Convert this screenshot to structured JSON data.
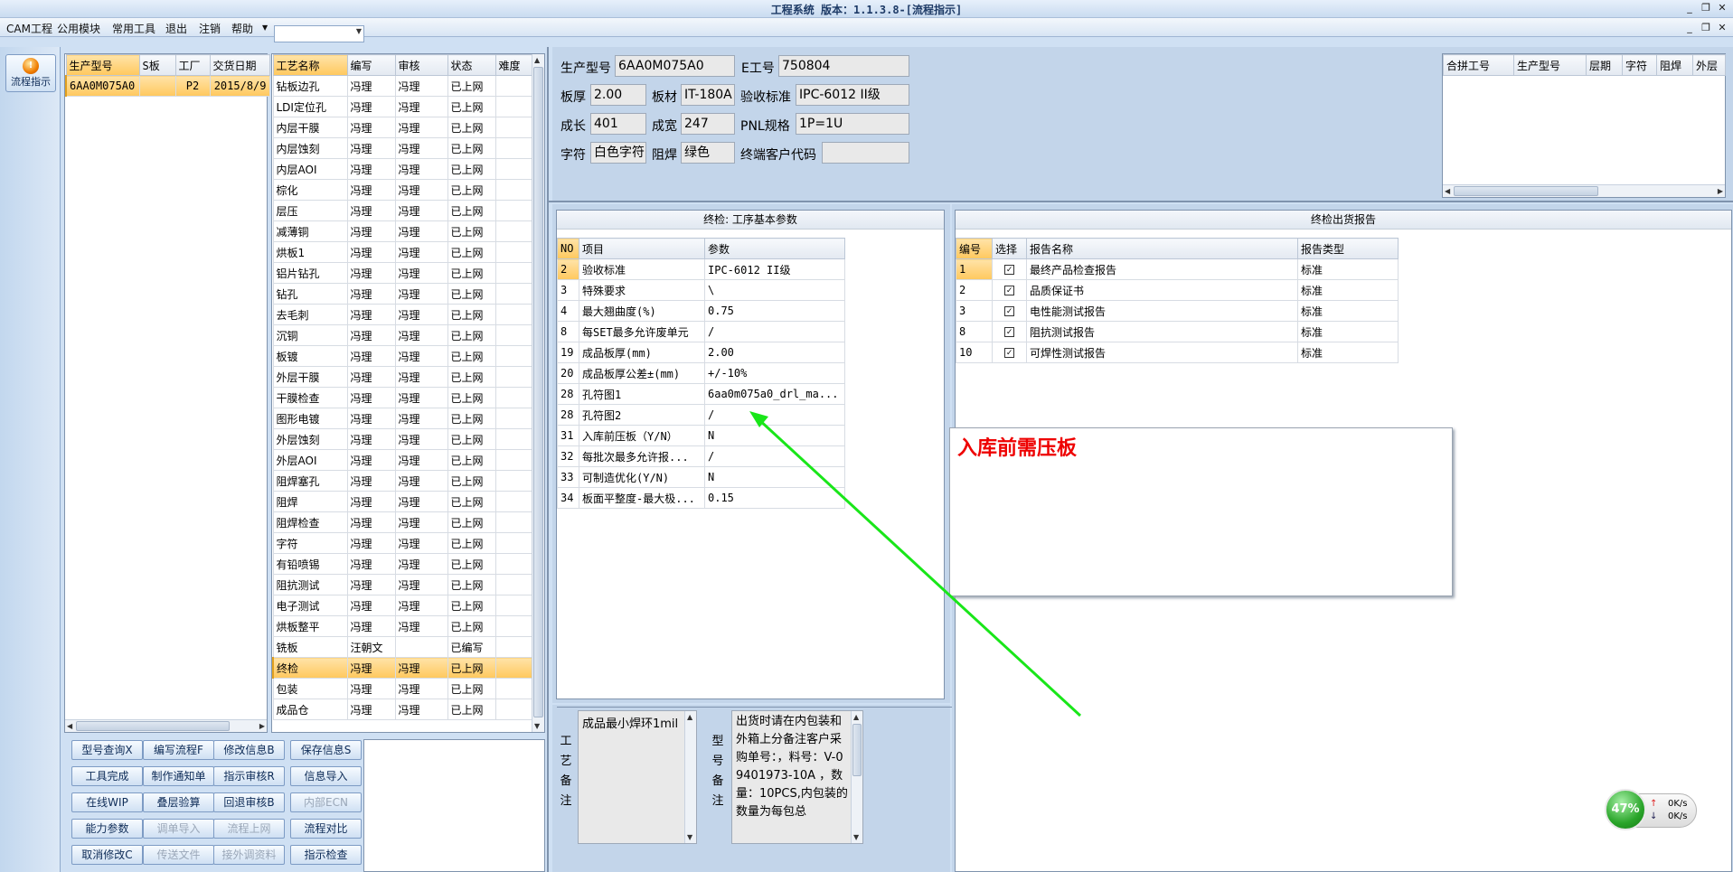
{
  "window": {
    "title": "工程系统 版本：1.1.3.8-[流程指示]"
  },
  "menu": [
    "CAM工程",
    "公用模块",
    "常用工具",
    "退出",
    "注销",
    "帮助"
  ],
  "menu_combo_value": "",
  "nav": {
    "label": "流程指示"
  },
  "orders": {
    "headers": [
      "生产型号",
      "S板",
      "工厂",
      "交货日期"
    ],
    "rows": [
      [
        "6AA0M075A0",
        "",
        "P2",
        "2015/8/9"
      ]
    ]
  },
  "process": {
    "headers": [
      "工艺名称",
      "编写",
      "审核",
      "状态",
      "难度"
    ],
    "rows": [
      [
        "钻板边孔",
        "冯理",
        "冯理",
        "已上网",
        ""
      ],
      [
        "LDI定位孔",
        "冯理",
        "冯理",
        "已上网",
        ""
      ],
      [
        "内层干膜",
        "冯理",
        "冯理",
        "已上网",
        ""
      ],
      [
        "内层蚀刻",
        "冯理",
        "冯理",
        "已上网",
        ""
      ],
      [
        "内层AOI",
        "冯理",
        "冯理",
        "已上网",
        ""
      ],
      [
        "棕化",
        "冯理",
        "冯理",
        "已上网",
        ""
      ],
      [
        "层压",
        "冯理",
        "冯理",
        "已上网",
        ""
      ],
      [
        "减薄铜",
        "冯理",
        "冯理",
        "已上网",
        ""
      ],
      [
        "烘板1",
        "冯理",
        "冯理",
        "已上网",
        ""
      ],
      [
        "铝片钻孔",
        "冯理",
        "冯理",
        "已上网",
        ""
      ],
      [
        "钻孔",
        "冯理",
        "冯理",
        "已上网",
        ""
      ],
      [
        "去毛刺",
        "冯理",
        "冯理",
        "已上网",
        ""
      ],
      [
        "沉铜",
        "冯理",
        "冯理",
        "已上网",
        ""
      ],
      [
        "板镀",
        "冯理",
        "冯理",
        "已上网",
        ""
      ],
      [
        "外层干膜",
        "冯理",
        "冯理",
        "已上网",
        ""
      ],
      [
        "干膜检查",
        "冯理",
        "冯理",
        "已上网",
        ""
      ],
      [
        "图形电镀",
        "冯理",
        "冯理",
        "已上网",
        ""
      ],
      [
        "外层蚀刻",
        "冯理",
        "冯理",
        "已上网",
        ""
      ],
      [
        "外层AOI",
        "冯理",
        "冯理",
        "已上网",
        ""
      ],
      [
        "阻焊塞孔",
        "冯理",
        "冯理",
        "已上网",
        ""
      ],
      [
        "阻焊",
        "冯理",
        "冯理",
        "已上网",
        ""
      ],
      [
        "阻焊检查",
        "冯理",
        "冯理",
        "已上网",
        ""
      ],
      [
        "字符",
        "冯理",
        "冯理",
        "已上网",
        ""
      ],
      [
        "有铅喷锡",
        "冯理",
        "冯理",
        "已上网",
        ""
      ],
      [
        "阻抗测试",
        "冯理",
        "冯理",
        "已上网",
        ""
      ],
      [
        "电子测试",
        "冯理",
        "冯理",
        "已上网",
        ""
      ],
      [
        "烘板整平",
        "冯理",
        "冯理",
        "已上网",
        ""
      ],
      [
        "铣板",
        "汪朝文",
        "",
        "已编写",
        ""
      ],
      [
        "终检",
        "冯理",
        "冯理",
        "已上网",
        ""
      ],
      [
        "包装",
        "冯理",
        "冯理",
        "已上网",
        ""
      ],
      [
        "成品仓",
        "冯理",
        "冯理",
        "已上网",
        ""
      ]
    ],
    "selected_index": 28
  },
  "buttons": [
    [
      "型号查询X",
      "编写流程F",
      "修改信息B",
      "保存信息S"
    ],
    [
      "工具完成",
      "制作通知单",
      "指示审核R",
      "信息导入"
    ],
    [
      "在线WIP",
      "叠层验算",
      "回退审核B",
      "内部ECN"
    ],
    [
      "能力参数",
      "调单导入",
      "流程上网",
      "流程对比"
    ],
    [
      "取消修改C",
      "传送文件",
      "接外调资料",
      "指示检查"
    ]
  ],
  "info": {
    "prod_model_label": "生产型号",
    "prod_model": "6AA0M075A0",
    "e_no_label": "E工号",
    "e_no": "750804",
    "thickness_label": "板厚",
    "thickness": "2.00",
    "material_label": "板材",
    "material": "IT-180A",
    "standard_label": "验收标准",
    "standard": "IPC-6012 II级",
    "length_label": "成长",
    "length": "401",
    "width_label": "成宽",
    "width": "247",
    "pnl_label": "PNL规格",
    "pnl": "1P=1U",
    "char_label": "字符",
    "char": "白色字符",
    "mask_label": "阻焊",
    "mask": "绿色",
    "client_label": "终端客户代码",
    "client": ""
  },
  "merge": {
    "headers": [
      "合拼工号",
      "生产型号",
      "层期",
      "字符",
      "阻焊",
      "外层"
    ]
  },
  "params": {
    "title": "终检: 工序基本参数",
    "headers": [
      "NO",
      "项目",
      "参数"
    ],
    "rows": [
      [
        "2",
        "验收标准",
        "IPC-6012 II级"
      ],
      [
        "3",
        "特殊要求",
        "\\"
      ],
      [
        "4",
        "最大翘曲度(%)",
        "0.75"
      ],
      [
        "8",
        "每SET最多允许废单元",
        "/"
      ],
      [
        "19",
        "成品板厚(mm)",
        "2.00"
      ],
      [
        "20",
        "成品板厚公差±(mm)",
        "+/-10%"
      ],
      [
        "28",
        "孔符图1",
        "6aa0m075a0_drl_ma..."
      ],
      [
        "28",
        "孔符图2",
        "/"
      ],
      [
        "31",
        "入库前压板（Y/N）",
        "N"
      ],
      [
        "32",
        "每批次最多允许报...",
        "/"
      ],
      [
        "33",
        "可制造优化(Y/N)",
        "N"
      ],
      [
        "34",
        "板面平整度-最大极...",
        "0.15"
      ]
    ]
  },
  "reports": {
    "title": "终检出货报告",
    "headers": [
      "编号",
      "选择",
      "报告名称",
      "报告类型"
    ],
    "rows": [
      [
        "1",
        "✓",
        "最终产品检查报告",
        "标准"
      ],
      [
        "2",
        "✓",
        "品质保证书",
        "标准"
      ],
      [
        "3",
        "✓",
        "电性能测试报告",
        "标准"
      ],
      [
        "8",
        "✓",
        "阻抗测试报告",
        "标准"
      ],
      [
        "10",
        "✓",
        "可焊性测试报告",
        "标准"
      ]
    ]
  },
  "notes": {
    "process_label": [
      "工",
      "艺",
      "备",
      "注"
    ],
    "process_note": "成品最小焊环1mil",
    "model_label": [
      "型",
      "号",
      "备",
      "注"
    ],
    "model_note": "出货时请在内包装和外箱上分备注客户采购单号：，料号：V-09401973-10A ，数量：10PCS,内包装的数量为每包总"
  },
  "callout": {
    "text": "入库前需压板"
  },
  "speed": {
    "percent": "47%",
    "up": "0K/s",
    "down": "0K/s"
  },
  "colors": {
    "arrow": "#19e619",
    "callout_text": "#ee0000",
    "selected_row": "#ffc85e"
  }
}
